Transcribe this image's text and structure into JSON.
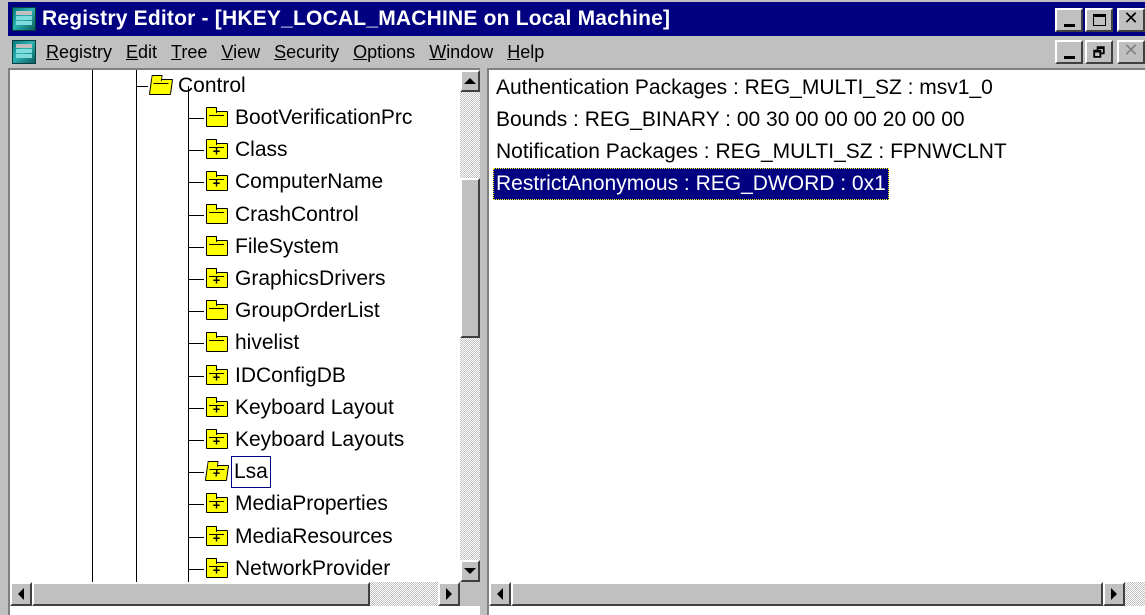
{
  "window": {
    "title": "Registry Editor - [HKEY_LOCAL_MACHINE on Local Machine]"
  },
  "menu": {
    "items": [
      "Registry",
      "Edit",
      "Tree",
      "View",
      "Security",
      "Options",
      "Window",
      "Help"
    ]
  },
  "tree": {
    "parent": "Control",
    "children": [
      {
        "label": "BootVerificationPrc",
        "expandable": false
      },
      {
        "label": "Class",
        "expandable": true
      },
      {
        "label": "ComputerName",
        "expandable": true
      },
      {
        "label": "CrashControl",
        "expandable": false
      },
      {
        "label": "FileSystem",
        "expandable": false
      },
      {
        "label": "GraphicsDrivers",
        "expandable": true
      },
      {
        "label": "GroupOrderList",
        "expandable": false
      },
      {
        "label": "hivelist",
        "expandable": false
      },
      {
        "label": "IDConfigDB",
        "expandable": true
      },
      {
        "label": "Keyboard Layout",
        "expandable": true
      },
      {
        "label": "Keyboard Layouts",
        "expandable": true
      },
      {
        "label": "Lsa",
        "expandable": true,
        "selected": true
      },
      {
        "label": "MediaProperties",
        "expandable": true
      },
      {
        "label": "MediaResources",
        "expandable": true
      },
      {
        "label": "NetworkProvider",
        "expandable": true
      }
    ]
  },
  "values": [
    {
      "text": "Authentication Packages : REG_MULTI_SZ : msv1_0",
      "selected": false
    },
    {
      "text": "Bounds : REG_BINARY : 00 30 00 00 00 20 00 00",
      "selected": false
    },
    {
      "text": "Notification Packages : REG_MULTI_SZ : FPNWCLNT",
      "selected": false
    },
    {
      "text": "RestrictAnonymous : REG_DWORD : 0x1",
      "selected": true
    }
  ],
  "icons": {
    "app": "registry-icon",
    "minimize": "minimize-icon",
    "maximize": "maximize-icon",
    "restore": "restore-icon",
    "close": "close-icon",
    "folder": "folder-icon",
    "folder_open": "open-folder-icon"
  },
  "colors": {
    "titlebar": "#000080",
    "selection": "#000080",
    "folder": "#ffff00",
    "face": "#c0c0c0"
  }
}
